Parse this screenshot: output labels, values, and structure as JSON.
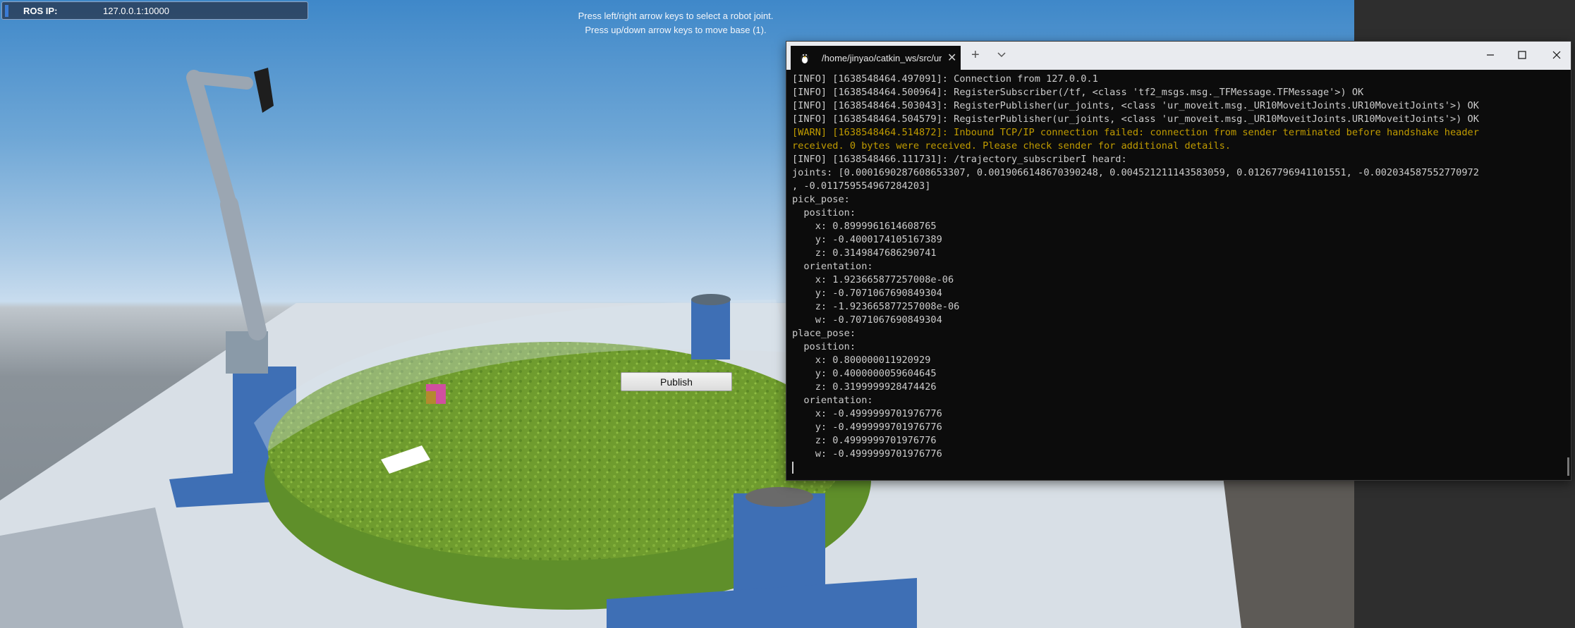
{
  "hud": {
    "ros_ip_label": "ROS IP:",
    "ros_ip_value": "127.0.0.1:10000"
  },
  "hint": {
    "line1": "Press left/right arrow keys to select a robot joint.",
    "line2": "Press up/down arrow keys to move base (1)."
  },
  "publish_button": {
    "label": "Publish"
  },
  "terminal": {
    "tab_title": "/home/jinyao/catkin_ws/src/ur_",
    "icons": {
      "tab": "tux-icon",
      "close_tab": "close-icon",
      "new_tab": "plus-icon",
      "dropdown": "chevron-down-icon"
    },
    "lines": [
      {
        "text": "[INFO] [1638548464.497091]: Connection from 127.0.0.1",
        "level": "info"
      },
      {
        "text": "[INFO] [1638548464.500964]: RegisterSubscriber(/tf, <class 'tf2_msgs.msg._TFMessage.TFMessage'>) OK",
        "level": "info"
      },
      {
        "text": "[INFO] [1638548464.503043]: RegisterPublisher(ur_joints, <class 'ur_moveit.msg._UR10MoveitJoints.UR10MoveitJoints'>) OK",
        "level": "info"
      },
      {
        "text": "[INFO] [1638548464.504579]: RegisterPublisher(ur_joints, <class 'ur_moveit.msg._UR10MoveitJoints.UR10MoveitJoints'>) OK",
        "level": "info"
      },
      {
        "text": "[WARN] [1638548464.514872]: Inbound TCP/IP connection failed: connection from sender terminated before handshake header",
        "level": "warn"
      },
      {
        "text": "received. 0 bytes were received. Please check sender for additional details.",
        "level": "warn"
      },
      {
        "text": "[INFO] [1638548466.111731]: /trajectory_subscriberI heard:",
        "level": "info"
      },
      {
        "text": "joints: [0.0001690287608653307, 0.0019066148670390248, 0.004521211143583059, 0.01267796941101551, -0.002034587552770972",
        "level": "info"
      },
      {
        "text": ", -0.011759554967284203]",
        "level": "info"
      },
      {
        "text": "pick_pose:",
        "level": "info"
      },
      {
        "text": "  position:",
        "level": "info"
      },
      {
        "text": "    x: 0.8999961614608765",
        "level": "info"
      },
      {
        "text": "    y: -0.4000174105167389",
        "level": "info"
      },
      {
        "text": "    z: 0.3149847686290741",
        "level": "info"
      },
      {
        "text": "  orientation:",
        "level": "info"
      },
      {
        "text": "    x: 1.923665877257008e-06",
        "level": "info"
      },
      {
        "text": "    y: -0.7071067690849304",
        "level": "info"
      },
      {
        "text": "    z: -1.923665877257008e-06",
        "level": "info"
      },
      {
        "text": "    w: -0.7071067690849304",
        "level": "info"
      },
      {
        "text": "place_pose:",
        "level": "info"
      },
      {
        "text": "  position:",
        "level": "info"
      },
      {
        "text": "    x: 0.800000011920929",
        "level": "info"
      },
      {
        "text": "    y: 0.4000000059604645",
        "level": "info"
      },
      {
        "text": "    z: 0.3199999928474426",
        "level": "info"
      },
      {
        "text": "  orientation:",
        "level": "info"
      },
      {
        "text": "    x: -0.4999999701976776",
        "level": "info"
      },
      {
        "text": "    y: -0.4999999701976776",
        "level": "info"
      },
      {
        "text": "    z: 0.4999999701976776",
        "level": "info"
      },
      {
        "text": "    w: -0.4999999701976776",
        "level": "info"
      }
    ]
  },
  "colors": {
    "terminal_bg": "#0c0c0c",
    "terminal_text": "#cccccc",
    "warn_text": "#c19c00",
    "grass": "#6f9c2e",
    "robot_blue": "#3e6fb5"
  }
}
